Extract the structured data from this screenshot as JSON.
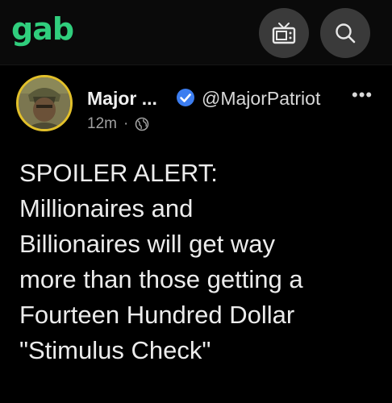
{
  "app": {
    "logo_text": "gab",
    "brand_color": "#30ce7d"
  },
  "header": {
    "tv_icon": "tv-icon",
    "search_icon": "search-icon"
  },
  "post": {
    "author_name": "Major ...",
    "handle": "@MajorPatriot",
    "timestamp": "12m",
    "separator": "·",
    "visibility_icon": "globe-icon",
    "more_label": "•••",
    "body_lines": [
      "SPOILER ALERT:",
      "Millionaires and",
      "Billionaires will get way",
      "more than those getting a",
      "Fourteen Hundred Dollar",
      "\"Stimulus Check\""
    ]
  }
}
